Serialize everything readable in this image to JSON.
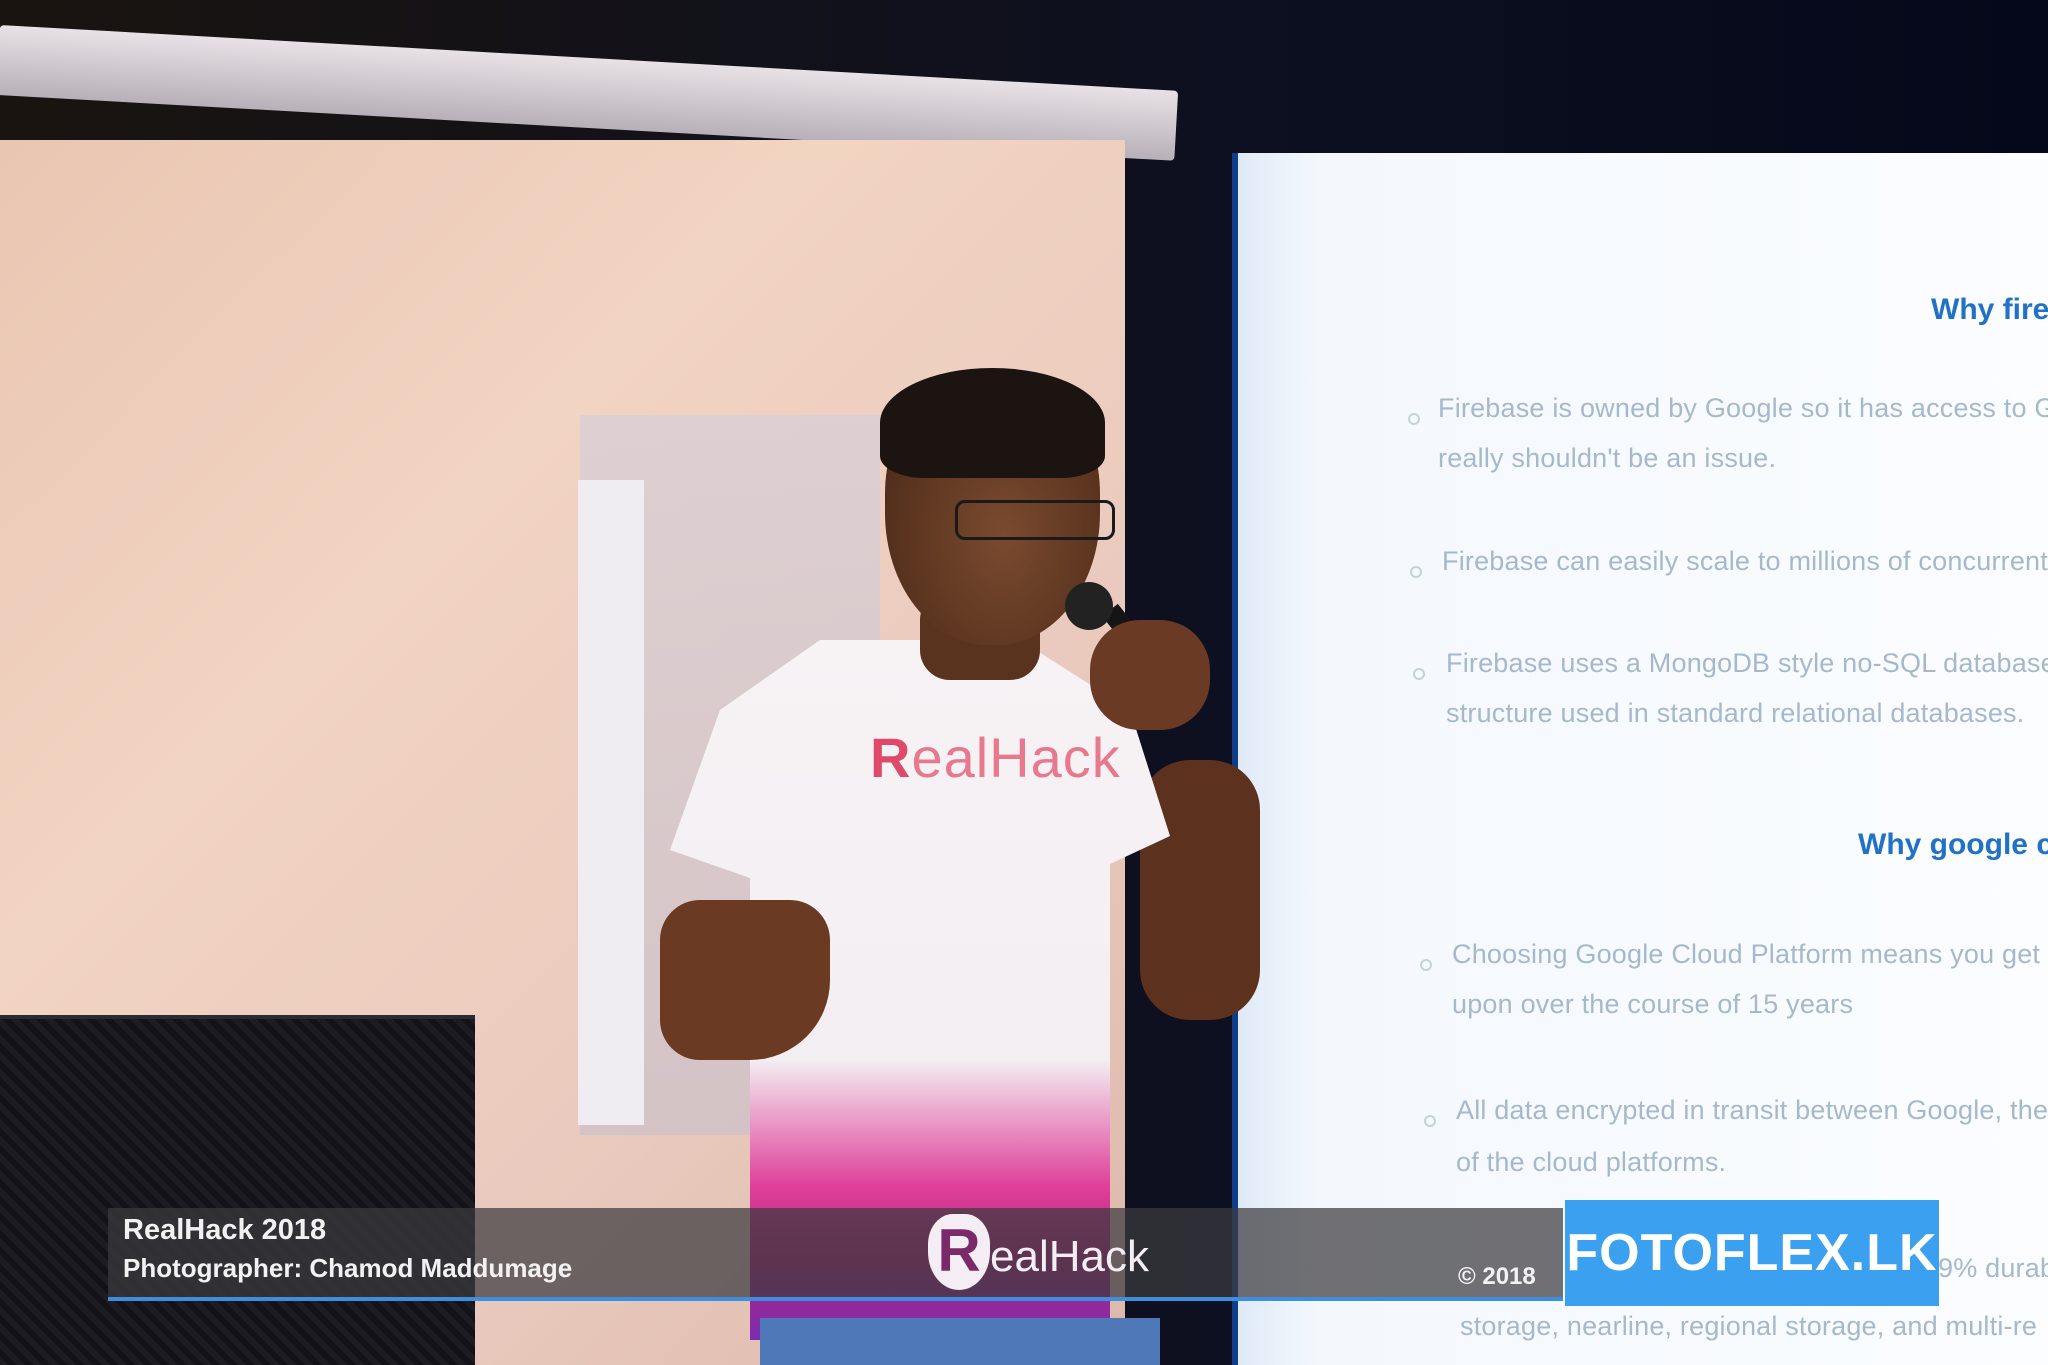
{
  "slide": {
    "heading_1": "Why fireb",
    "bullets_1": [
      [
        "Firebase is owned by Google so it has access to Goog",
        "really shouldn't be an issue."
      ],
      [
        "Firebase can easily scale to millions of concurrent co"
      ],
      [
        "Firebase uses a MongoDB style no-SQL database. Th",
        "structure used in standard relational databases."
      ]
    ],
    "heading_2": "Why google clo",
    "bullets_2": [
      [
        "Choosing Google Cloud Platform means you get th",
        "upon over the course of 15 years"
      ],
      [
        "All data encrypted in transit between Google, the",
        "of the cloud platforms."
      ],
      [
        "9% durab",
        "storage, nearline, regional storage, and multi-re"
      ]
    ]
  },
  "shirt": {
    "logo_r": "R",
    "logo_rest": "ealHack"
  },
  "watermark": {
    "title": "RealHack 2018",
    "photographer": "Photographer: Chamod Maddumage",
    "logo_r": "R",
    "logo_text": "ealHack",
    "copyright": "© 2018",
    "brand": "FOTOFLEX.LK"
  }
}
